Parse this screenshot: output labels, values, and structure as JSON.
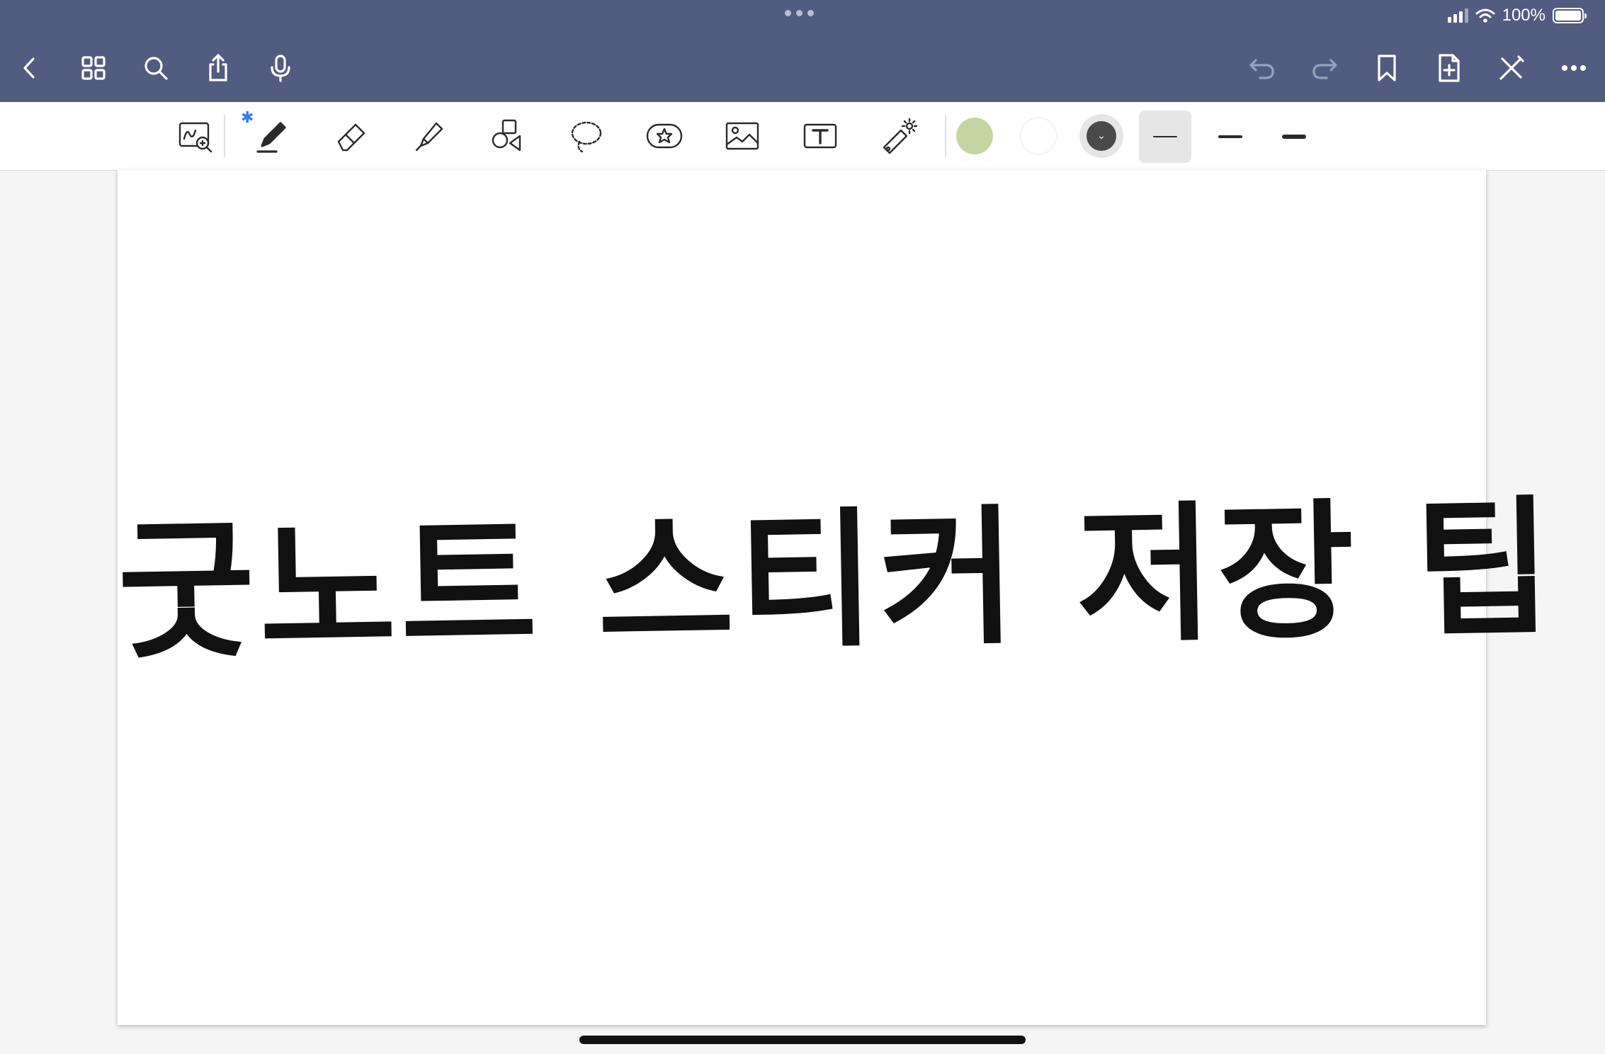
{
  "status_bar": {
    "battery_text": "100%"
  },
  "nav": {
    "left_icons": [
      "back-icon",
      "grid-icon",
      "search-icon",
      "share-icon",
      "microphone-icon"
    ],
    "right_icons": [
      "undo-icon",
      "redo-icon",
      "bookmark-icon",
      "add-page-icon",
      "close-pen-icon",
      "more-icon"
    ]
  },
  "tools": {
    "items": [
      "zoom-window-icon",
      "pen-icon",
      "eraser-icon",
      "highlighter-icon",
      "shapes-icon",
      "lasso-icon",
      "sticker-icon",
      "image-icon",
      "text-icon",
      "laser-pointer-icon"
    ],
    "bluetooth_symbol": "✱"
  },
  "colors": {
    "swatches": [
      "#c3d6a2",
      "#ffffff",
      "#4a4a4a"
    ],
    "selected": "#4a4a4a",
    "topbar": "#525c80"
  },
  "page": {
    "handwritten_text": "굿노트 스티커 저장 팁"
  }
}
